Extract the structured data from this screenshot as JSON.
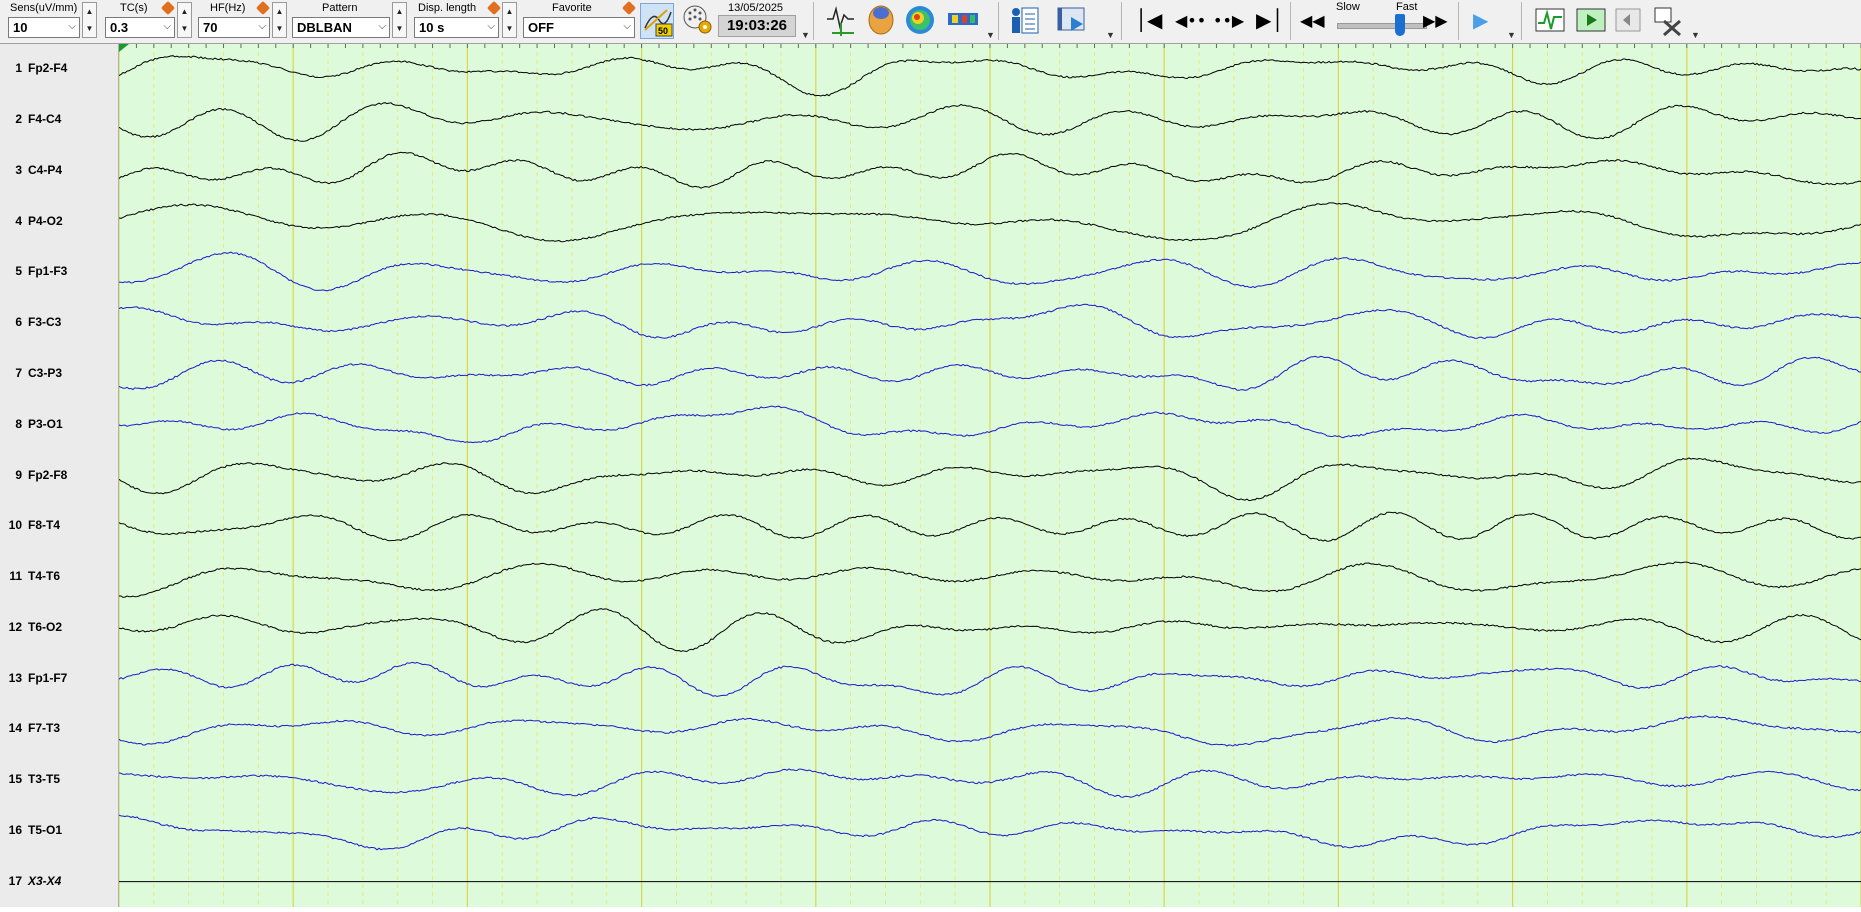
{
  "toolbar": {
    "sens": {
      "label": "Sens(uV/mm)",
      "value": "10"
    },
    "tc": {
      "label": "TC(s)",
      "value": "0.3"
    },
    "hf": {
      "label": "HF(Hz)",
      "value": "70"
    },
    "pattern": {
      "label": "Pattern",
      "value": "DBLBAN"
    },
    "disp_length": {
      "label": "Disp. length",
      "value": "10 s"
    },
    "favorite": {
      "label": "Favorite",
      "value": "OFF"
    },
    "filter_badge": "50",
    "date": "13/05/2025",
    "time": "19:03:26",
    "slow_label": "Slow",
    "fast_label": "Fast",
    "speed_fraction": 0.72
  },
  "channels": [
    {
      "n": "1",
      "name": "Fp2-F4",
      "color": "#000000"
    },
    {
      "n": "2",
      "name": "F4-C4",
      "color": "#000000"
    },
    {
      "n": "3",
      "name": "C4-P4",
      "color": "#000000"
    },
    {
      "n": "4",
      "name": "P4-O2",
      "color": "#000000"
    },
    {
      "n": "5",
      "name": "Fp1-F3",
      "color": "#1a1acc"
    },
    {
      "n": "6",
      "name": "F3-C3",
      "color": "#1a1acc"
    },
    {
      "n": "7",
      "name": "C3-P3",
      "color": "#1a1acc"
    },
    {
      "n": "8",
      "name": "P3-O1",
      "color": "#1a1acc"
    },
    {
      "n": "9",
      "name": "Fp2-F8",
      "color": "#000000"
    },
    {
      "n": "10",
      "name": "F8-T4",
      "color": "#000000"
    },
    {
      "n": "11",
      "name": "T4-T6",
      "color": "#000000"
    },
    {
      "n": "12",
      "name": "T6-O2",
      "color": "#000000"
    },
    {
      "n": "13",
      "name": "Fp1-F7",
      "color": "#1a1acc"
    },
    {
      "n": "14",
      "name": "F7-T3",
      "color": "#1a1acc"
    },
    {
      "n": "15",
      "name": "T3-T5",
      "color": "#1a1acc"
    },
    {
      "n": "16",
      "name": "T5-O1",
      "color": "#1a1acc"
    },
    {
      "n": "17",
      "name": "X3-X4",
      "color": "#000000",
      "flat": true
    }
  ],
  "colors": {
    "trace_bg": "#ddfadb",
    "grid_second": "#d8d84a",
    "grid_minor": "#e8e86a",
    "left_trace": "#000000",
    "right_trace": "#1a1acc"
  },
  "icons": [
    "trace-montage-icon",
    "head-3d-icon",
    "topography-map-icon",
    "spectrum-icon",
    "patient-info-icon",
    "video-icon",
    "first-page-icon",
    "prev-page-icon",
    "next-page-icon",
    "last-page-icon",
    "rewind-icon",
    "fast-forward-icon",
    "play-icon",
    "amplitude-icon",
    "step-icon",
    "marker-icon",
    "tools-icon"
  ]
}
